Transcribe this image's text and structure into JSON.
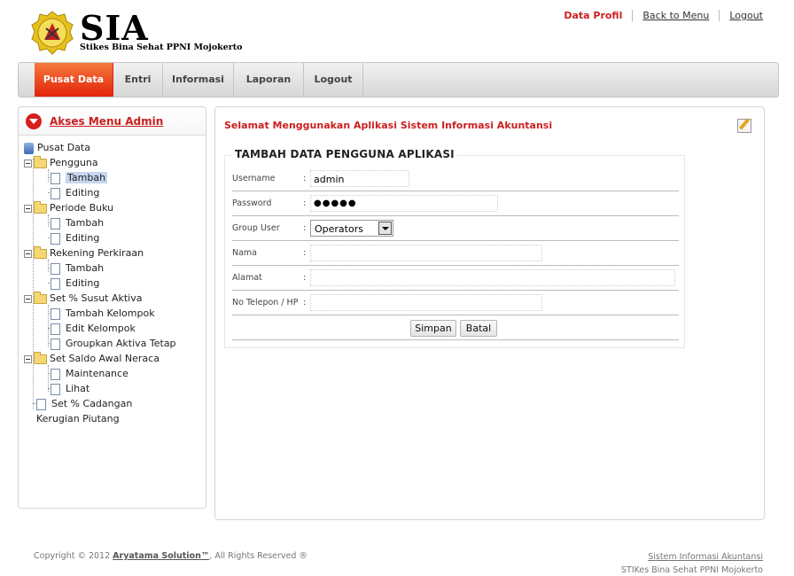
{
  "header": {
    "logo_title": "SIA",
    "logo_subtitle": "Stikes Bina Sehat PPNI Mojokerto",
    "seal_icon": "stikes-seal-icon",
    "links": [
      "Data Profil",
      "Back to Menu",
      "Logout"
    ]
  },
  "nav": {
    "tabs": [
      "Pusat Data",
      "Entri",
      "Informasi",
      "Laporan",
      "Logout"
    ],
    "active": "Pusat Data"
  },
  "sidebar": {
    "title": "Akses Menu Admin",
    "tree": [
      {
        "label": "Pusat Data",
        "type": "root"
      },
      {
        "label": "Pengguna",
        "type": "folder"
      },
      {
        "label": "Tambah",
        "type": "file",
        "selected": true
      },
      {
        "label": "Editing",
        "type": "file"
      },
      {
        "label": "Periode Buku",
        "type": "folder"
      },
      {
        "label": "Tambah",
        "type": "file"
      },
      {
        "label": "Editing",
        "type": "file"
      },
      {
        "label": "Rekening Perkiraan",
        "type": "folder"
      },
      {
        "label": "Tambah",
        "type": "file"
      },
      {
        "label": "Editing",
        "type": "file"
      },
      {
        "label": "Set % Susut Aktiva",
        "type": "folder"
      },
      {
        "label": "Tambah Kelompok",
        "type": "file"
      },
      {
        "label": "Edit Kelompok",
        "type": "file"
      },
      {
        "label": "Groupkan Aktiva Tetap",
        "type": "file"
      },
      {
        "label": "Set Saldo Awal Neraca",
        "type": "folder"
      },
      {
        "label": "Maintenance",
        "type": "file"
      },
      {
        "label": "Lihat",
        "type": "file"
      },
      {
        "label": "Set % Cadangan",
        "type": "file"
      },
      {
        "label": "Kerugian Piutang",
        "type": "text"
      }
    ]
  },
  "content": {
    "welcome": "Selamat Menggunakan Aplikasi Sistem Informasi Akuntansi",
    "form_title": "TAMBAH DATA PENGGUNA APLIKASI",
    "fields": {
      "username": {
        "label": "Username",
        "value": "admin"
      },
      "password": {
        "label": "Password",
        "value": "●●●●●"
      },
      "group_user": {
        "label": "Group User",
        "value": "Operators"
      },
      "nama": {
        "label": "Nama",
        "value": ""
      },
      "alamat": {
        "label": "Alamat",
        "value": ""
      },
      "telepon": {
        "label": "No Telepon / HP",
        "value": ""
      }
    },
    "colon": ":",
    "buttons": {
      "save": "Simpan",
      "cancel": "Batal"
    }
  },
  "footer": {
    "copyright_prefix": "Copyright © 2012 ",
    "company": "Aryatama Solution™",
    "copyright_suffix": ", All Rights Reserved ®",
    "right_line1": "Sistem Informasi Akuntansi",
    "right_line2": "STIKes Bina Sehat PPNI Mojokerto"
  },
  "colors": {
    "accent_red": "#cc1f1f",
    "active_tab": "#e2230b"
  }
}
